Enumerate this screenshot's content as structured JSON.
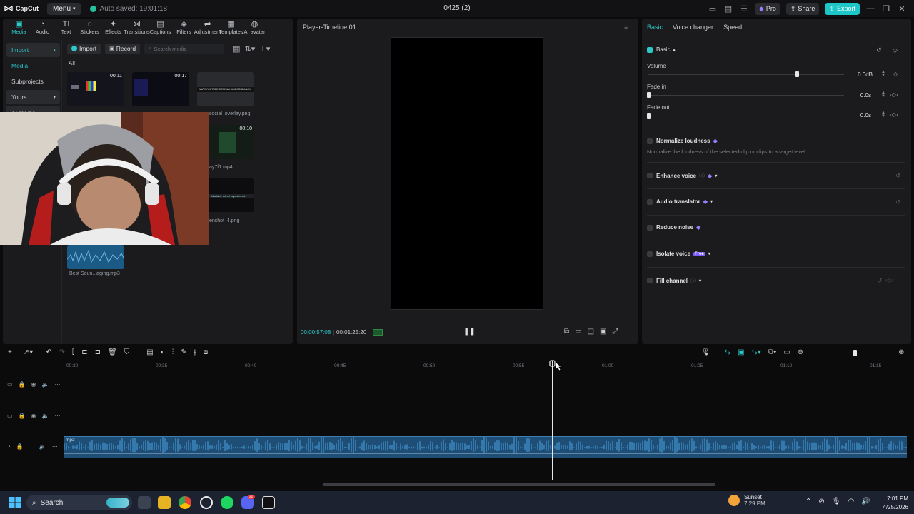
{
  "app": {
    "name": "CapCut",
    "menu_label": "Menu",
    "autosave": "Auto saved: 19:01:18",
    "project_title": "0425 (2)",
    "pro_label": "Pro",
    "share_label": "Share",
    "export_label": "Export"
  },
  "top_tools": [
    {
      "label": "Media",
      "glyph": "▣"
    },
    {
      "label": "Audio",
      "glyph": "◔"
    },
    {
      "label": "Text",
      "glyph": "TI"
    },
    {
      "label": "Stickers",
      "glyph": "◌"
    },
    {
      "label": "Effects",
      "glyph": "✦"
    },
    {
      "label": "Transitions",
      "glyph": "⋈"
    },
    {
      "label": "Captions",
      "glyph": "▤"
    },
    {
      "label": "Filters",
      "glyph": "◈"
    },
    {
      "label": "Adjustment",
      "glyph": "⇌"
    },
    {
      "label": "Templates",
      "glyph": "▦"
    },
    {
      "label": "AI avatar",
      "glyph": "◍"
    }
  ],
  "left_nav": {
    "import": "Import",
    "media": "Media",
    "subprojects": "Subprojects",
    "yours": "Yours",
    "ai_media": "AI media"
  },
  "media_toolbar": {
    "import": "Import",
    "record": "Record",
    "search_placeholder": "Search media"
  },
  "media": {
    "filter_all": "All",
    "items": [
      {
        "duration": "00:11",
        "caption": ""
      },
      {
        "duration": "00:17",
        "caption": ""
      },
      {
        "duration": "",
        "caption": "social_overlay.png",
        "banner": "WWW.YOUTUBE.COM/MAHMUDSOREANOV"
      },
      {
        "duration": "00:10",
        "caption": "ay7f1.mp4"
      },
      {
        "duration": "",
        "caption": "enshot_4.png",
        "banner": "Nasilsiniz cok mi beyenilim abi"
      },
      {
        "duration": "",
        "caption": "Best Soun...aging.mp3"
      }
    ]
  },
  "player": {
    "title": "Player-Timeline 01",
    "time_current": "00:00:57:08",
    "time_total": "00:01:25:20"
  },
  "right_panel": {
    "tabs": [
      "Basic",
      "Voice changer",
      "Speed"
    ],
    "basic_label": "Basic",
    "volume_label": "Volume",
    "volume_value": "0.0dB",
    "volume_level": 0.76,
    "fade_in_label": "Fade in",
    "fade_in_value": "0.0s",
    "fade_out_label": "Fade out",
    "fade_out_value": "0.0s",
    "normalize_label": "Normalize loudness",
    "normalize_desc": "Normalize the loudness of the selected clip or clips to a target level.",
    "enhance_label": "Enhance voice",
    "translator_label": "Audio translator",
    "reduce_noise_label": "Reduce noise",
    "isolate_label": "Isolate voice",
    "free_badge": "Free",
    "fill_channel_label": "Fill channel"
  },
  "timeline": {
    "ticks": [
      "00:30",
      "00:35",
      "00:40",
      "00:45",
      "00:50",
      "00:55",
      "01:00",
      "01:05",
      "01:10",
      "01:15"
    ],
    "clip_name": "mp3"
  },
  "taskbar": {
    "search_label": "Search",
    "weather_title": "Sunset",
    "weather_time": "7:29 PM",
    "clock_time": "7:01 PM",
    "clock_date": "4/25/2026",
    "discord_badge": "20"
  },
  "colors": {
    "accent": "#2ec8c8",
    "audio_clip": "#1e4e76",
    "panel": "#1b1b1d"
  }
}
